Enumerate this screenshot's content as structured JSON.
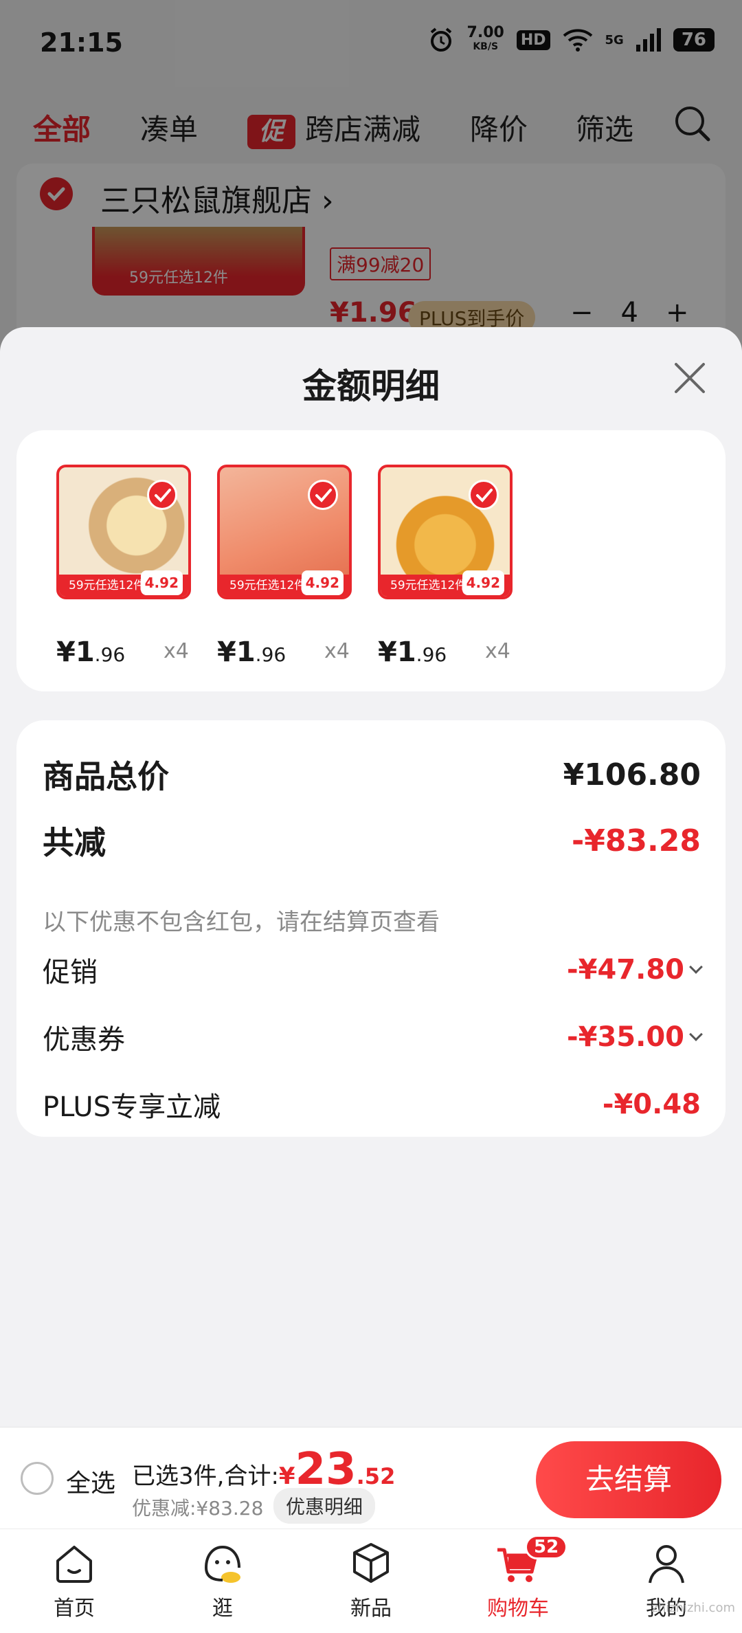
{
  "status_bar": {
    "time": "21:15",
    "net_speed": "7.00",
    "net_unit": "KB/S",
    "hd": "HD",
    "network": "5G",
    "battery": "76"
  },
  "filter_tabs": {
    "all": "全部",
    "bundle": "凑单",
    "promo_icon": "促",
    "cross_store": "跨店满减",
    "price_drop": "降价",
    "filter": "筛选"
  },
  "store": {
    "name": "三只松鼠旗舰店",
    "thumb_banner": "59元任选12件",
    "tag": "满99减20",
    "price": "¥1.96",
    "plus_tag": "PLUS到手价",
    "qty": "4"
  },
  "sheet": {
    "title": "金额明细",
    "goods": [
      {
        "banner": "59元任选12件",
        "badge": "4.92",
        "price_int": "¥1",
        "price_dec": ".96",
        "qty": "x4"
      },
      {
        "banner": "59元任选12件",
        "badge": "4.92",
        "price_int": "¥1",
        "price_dec": ".96",
        "qty": "x4"
      },
      {
        "banner": "59元任选12件",
        "badge": "4.92",
        "price_int": "¥1",
        "price_dec": ".96",
        "qty": "x4"
      }
    ],
    "total_label": "商品总价",
    "total_value": "¥106.80",
    "reduce_label": "共减",
    "reduce_value": "-¥83.28",
    "reduce_note": "以下优惠不包含红包，请在结算页查看",
    "promo_label": "促销",
    "promo_value": "-¥47.80",
    "coupon_label": "优惠券",
    "coupon_value": "-¥35.00",
    "plus_label": "PLUS专享立减",
    "plus_value": "-¥0.48"
  },
  "checkout": {
    "select_all": "全选",
    "selected_text": "已选3件,合计:",
    "currency": "¥",
    "amount_int": "23",
    "amount_dec": ".52",
    "discount_text": "优惠减:¥83.28",
    "discount_detail": "优惠明细",
    "pay": "去结算"
  },
  "tabbar": {
    "home": "首页",
    "browse": "逛",
    "new": "新品",
    "cart": "购物车",
    "cart_badge": "52",
    "mine": "我的"
  },
  "watermark": "zhizhizhi.com",
  "colors": {
    "accent": "#e8262c",
    "background": "#f2f2f4"
  }
}
